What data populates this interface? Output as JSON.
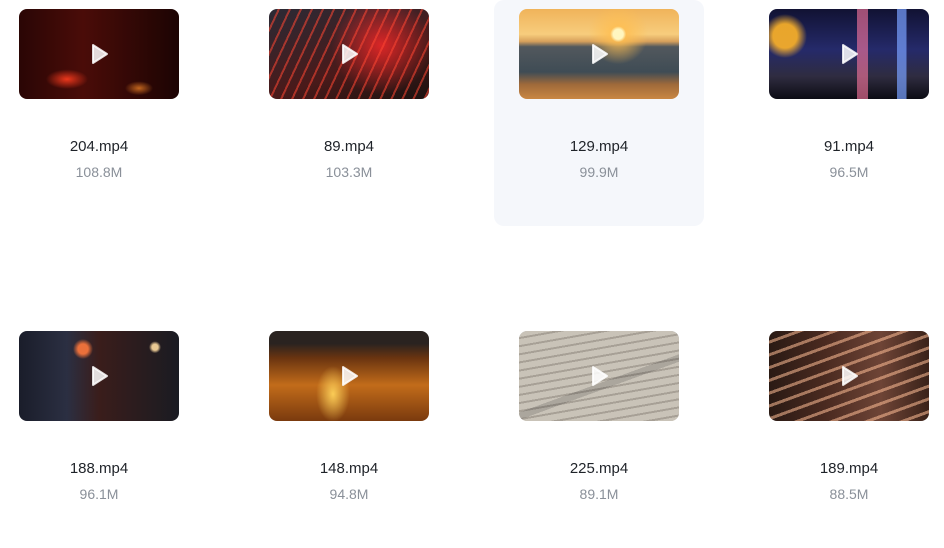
{
  "videos": [
    {
      "name": "204.mp4",
      "size": "108.8M",
      "thumb_icon": "play-icon"
    },
    {
      "name": "89.mp4",
      "size": "103.3M",
      "thumb_icon": "play-icon"
    },
    {
      "name": "129.mp4",
      "size": "99.9M",
      "thumb_icon": "play-icon"
    },
    {
      "name": "91.mp4",
      "size": "96.5M",
      "thumb_icon": "play-icon"
    },
    {
      "name": "188.mp4",
      "size": "96.1M",
      "thumb_icon": "play-icon"
    },
    {
      "name": "148.mp4",
      "size": "94.8M",
      "thumb_icon": "play-icon"
    },
    {
      "name": "225.mp4",
      "size": "89.1M",
      "thumb_icon": "play-icon"
    },
    {
      "name": "189.mp4",
      "size": "88.5M",
      "thumb_icon": "play-icon"
    }
  ],
  "colors": {
    "card_hover_bg": "#f5f7fb",
    "name_text": "#1f2329",
    "size_text": "#8a9099"
  }
}
